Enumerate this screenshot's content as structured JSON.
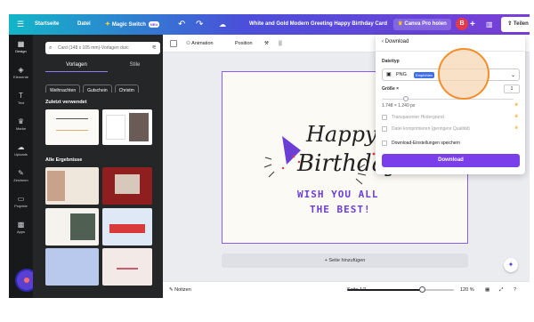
{
  "topbar": {
    "home": "Startseite",
    "file": "Datei",
    "magic_switch": "Magic Switch",
    "magic_badge": "NEU",
    "doc_title": "White and Gold Modern Greeting Happy Birthday Card",
    "pro": "Canva Pro holen",
    "avatar": "B",
    "share": "Teilen"
  },
  "rail": {
    "items": [
      "Design",
      "Elemente",
      "Text",
      "Marke",
      "Uploads",
      "Zeichnen",
      "Projekte",
      "Apps"
    ]
  },
  "panel": {
    "search_placeholder": "Card (148 x 105 mm)-Vorlagen durc",
    "tabs": [
      "Vorlagen",
      "Stile"
    ],
    "chips": [
      "Weihnachten",
      "Gutschein",
      "Christm"
    ],
    "recent_title": "Zuletzt verwendet",
    "results_title": "Alle Ergebnisse"
  },
  "canvas_toolbar": {
    "animation": "Animation",
    "position": "Position"
  },
  "card": {
    "line1": "Happy",
    "line2": "Birthday",
    "line3": "WISH YOU ALL",
    "line4": "THE BEST!"
  },
  "add_page": "+ Seite hinzufügen",
  "bottombar": {
    "notes": "Notizen",
    "page": "Seite 1/1",
    "zoom": "120 %",
    "zoom_fraction": 0.7
  },
  "download": {
    "title": "Download",
    "file_type_label": "Dateityp",
    "file_type_value": "PNG",
    "recommended": "Empfohlen",
    "size_label": "Größe ×",
    "size_value": "1",
    "dimensions": "1.748 × 1.240 px",
    "size_fraction": 0.18,
    "opt_transparent": "Transparenter Hintergrund",
    "opt_compress": "Datei komprimieren (geringere Qualität)",
    "opt_save": "Download-Einstellungen speichern",
    "button": "Download"
  },
  "colors": {
    "accent": "#7a3eea",
    "card_text": "#6b3ed6",
    "highlight": "#f28e2b"
  }
}
